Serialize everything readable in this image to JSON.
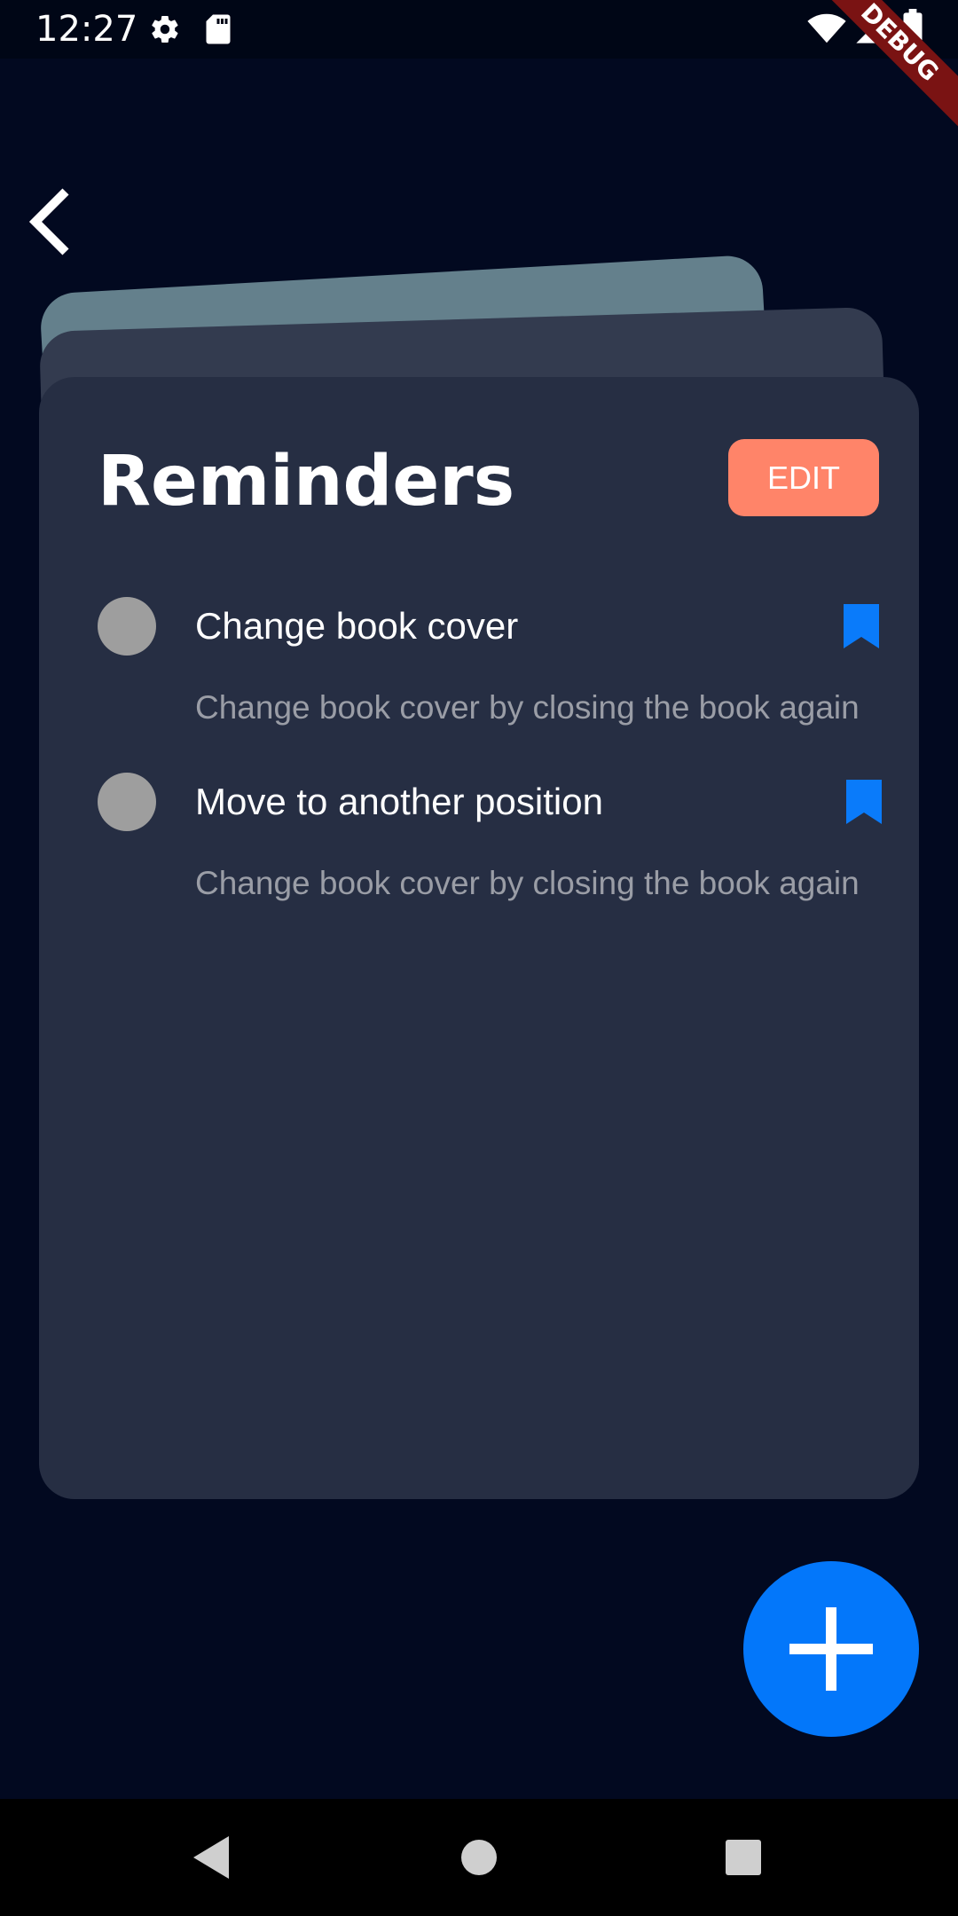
{
  "status_bar": {
    "time": "12:27",
    "icons": [
      "settings-icon",
      "sd-card-icon",
      "wifi-icon",
      "signal-icon",
      "battery-icon"
    ],
    "debug_label": "DEBUG"
  },
  "header": {
    "back_icon": "chevron-left-icon"
  },
  "card": {
    "title": "Reminders",
    "edit_label": "EDIT",
    "colors": {
      "card": "#262e43",
      "page_middle": "#333b4f",
      "page_back": "#64808c",
      "edit_button": "#ff8469"
    }
  },
  "reminders": [
    {
      "title": "Change book cover",
      "description": "Change book cover by closing the book again",
      "bookmark_icon": "bookmark-icon",
      "bookmark_color": "#0a7bfa"
    },
    {
      "title": "Move to another position",
      "description": "Change book cover by closing the book again",
      "bookmark_icon": "bookmark-icon",
      "bookmark_color": "#0a7bfa"
    }
  ],
  "fab": {
    "icon": "plus-icon",
    "color": "#0377fa"
  },
  "nav_bar": {
    "icons": [
      "back-triangle-icon",
      "home-circle-icon",
      "recents-square-icon"
    ]
  },
  "colors": {
    "background": "#020920"
  }
}
